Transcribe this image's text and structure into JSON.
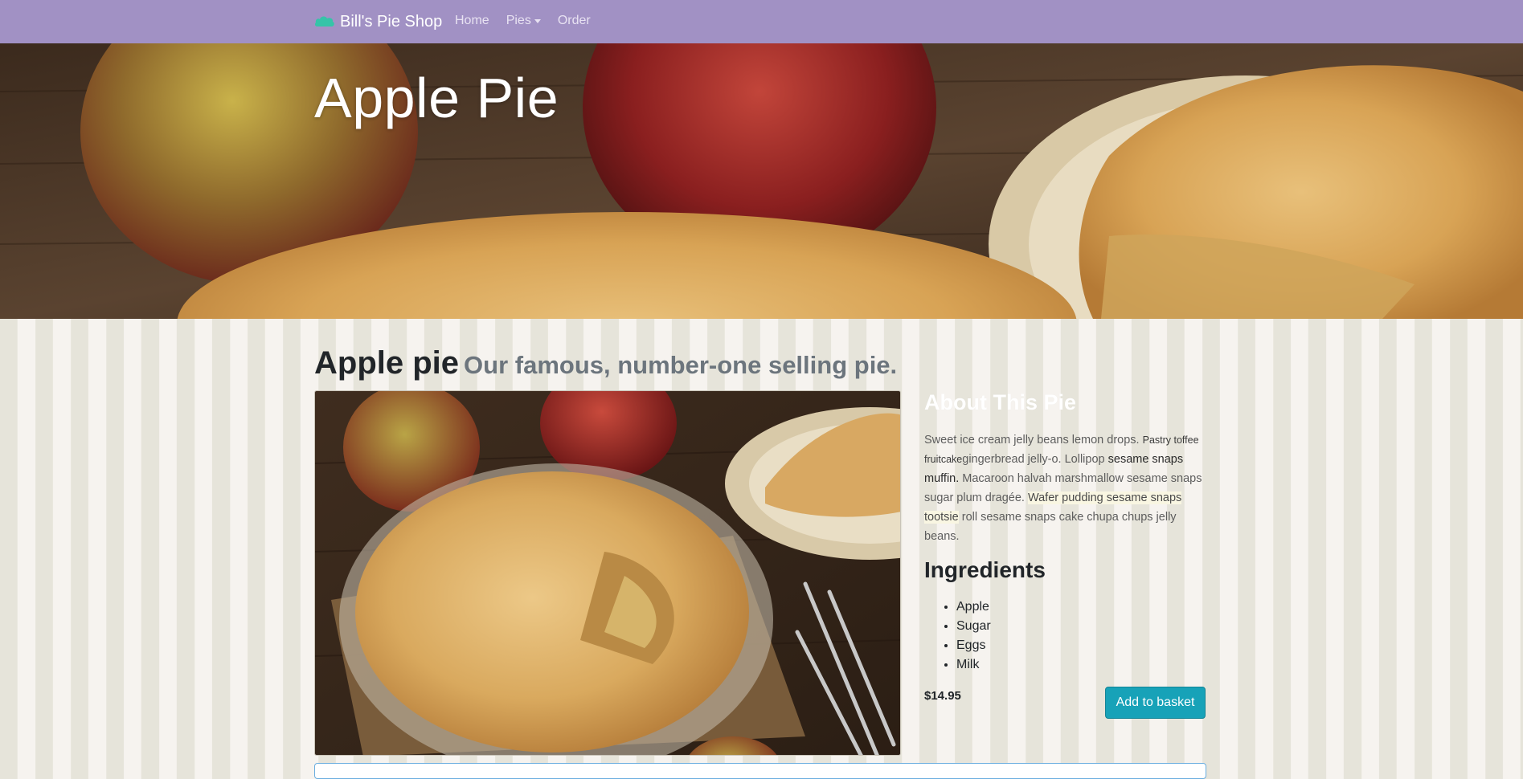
{
  "navbar": {
    "brand": "Bill's Pie Shop",
    "brand_icon": "pie-cloud-icon",
    "links": [
      {
        "label": "Home"
      },
      {
        "label": "Pies",
        "dropdown": true
      },
      {
        "label": "Order"
      }
    ]
  },
  "hero": {
    "title": "Apple Pie"
  },
  "product": {
    "name": "Apple pie",
    "tagline": "Our famous, number-one selling pie.",
    "about_title": "About This Pie",
    "about_segments": [
      "Sweet ice cream jelly beans lemon drops. ",
      "Pastry toffee fruitcake",
      "gingerbread jelly-o. Lollipop ",
      "sesame snaps muffin.",
      " Macaroon halvah marshmallow sesame snaps sugar plum dragée. ",
      "Wafer pudding sesame snaps tootsie",
      " roll sesame snaps cake chupa chups jelly beans."
    ],
    "ingredients_title": "Ingredients",
    "ingredients": [
      "Apple",
      "Sugar",
      "Eggs",
      "Milk"
    ],
    "price": "$14.95",
    "add_button": "Add to basket"
  },
  "colors": {
    "navbar": "#a191c4",
    "button": "#17a2b8",
    "stripe_dark": "#e6e4da",
    "stripe_light": "#f6f3ef"
  }
}
